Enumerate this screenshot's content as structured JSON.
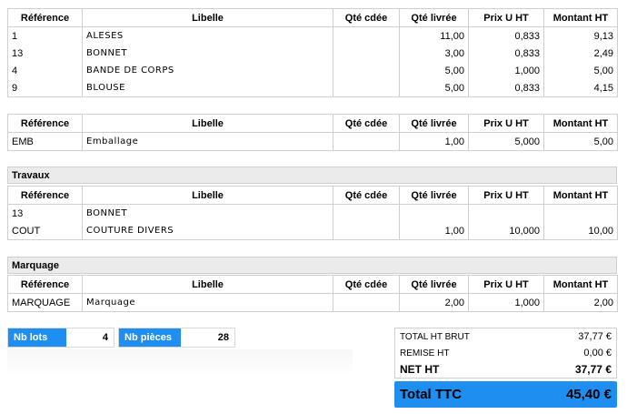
{
  "columns": [
    "Référence",
    "Libelle",
    "Qté cdée",
    "Qté livrée",
    "Prix U HT",
    "Montant HT"
  ],
  "sections": [
    {
      "title": "",
      "rows": [
        {
          "ref": "1",
          "libelle": "ALESES",
          "qte_cdee": "",
          "qte_livree": "11,00",
          "prix": "0,833",
          "montant": "9,13"
        },
        {
          "ref": "13",
          "libelle": "BONNET",
          "qte_cdee": "",
          "qte_livree": "3,00",
          "prix": "0,833",
          "montant": "2,49"
        },
        {
          "ref": "4",
          "libelle": "BANDE DE CORPS",
          "qte_cdee": "",
          "qte_livree": "5,00",
          "prix": "1,000",
          "montant": "5,00"
        },
        {
          "ref": "9",
          "libelle": "BLOUSE",
          "qte_cdee": "",
          "qte_livree": "5,00",
          "prix": "0,833",
          "montant": "4,15"
        }
      ]
    },
    {
      "title": "",
      "rows": [
        {
          "ref": "EMB",
          "libelle": "Emballage",
          "qte_cdee": "",
          "qte_livree": "1,00",
          "prix": "5,000",
          "montant": "5,00"
        }
      ]
    },
    {
      "title": "Travaux",
      "rows": [
        {
          "ref": "13",
          "libelle": "BONNET",
          "qte_cdee": "",
          "qte_livree": "",
          "prix": "",
          "montant": ""
        },
        {
          "ref": "COUT",
          "libelle": "COUTURE DIVERS",
          "qte_cdee": "",
          "qte_livree": "1,00",
          "prix": "10,000",
          "montant": "10,00"
        }
      ]
    },
    {
      "title": "Marquage",
      "rows": [
        {
          "ref": "MARQUAGE",
          "libelle": "Marquage",
          "qte_cdee": "",
          "qte_livree": "2,00",
          "prix": "1,000",
          "montant": "2,00"
        }
      ]
    }
  ],
  "counts": {
    "lots_label": "Nb lots",
    "lots_value": "4",
    "pieces_label": "Nb pièces",
    "pieces_value": "28"
  },
  "totals": {
    "total_ht_brut_label": "TOTAL HT BRUT",
    "total_ht_brut_value": "37,77 €",
    "remise_ht_label": "REMISE HT",
    "remise_ht_value": "0,00 €",
    "net_ht_label": "NET HT",
    "net_ht_value": "37,77 €",
    "ttc_label": "Total TTC",
    "ttc_value": "45,40 €"
  },
  "colors": {
    "accent": "#1e8ff0",
    "section_bg": "#ebebeb",
    "border": "#cfcfcf"
  }
}
